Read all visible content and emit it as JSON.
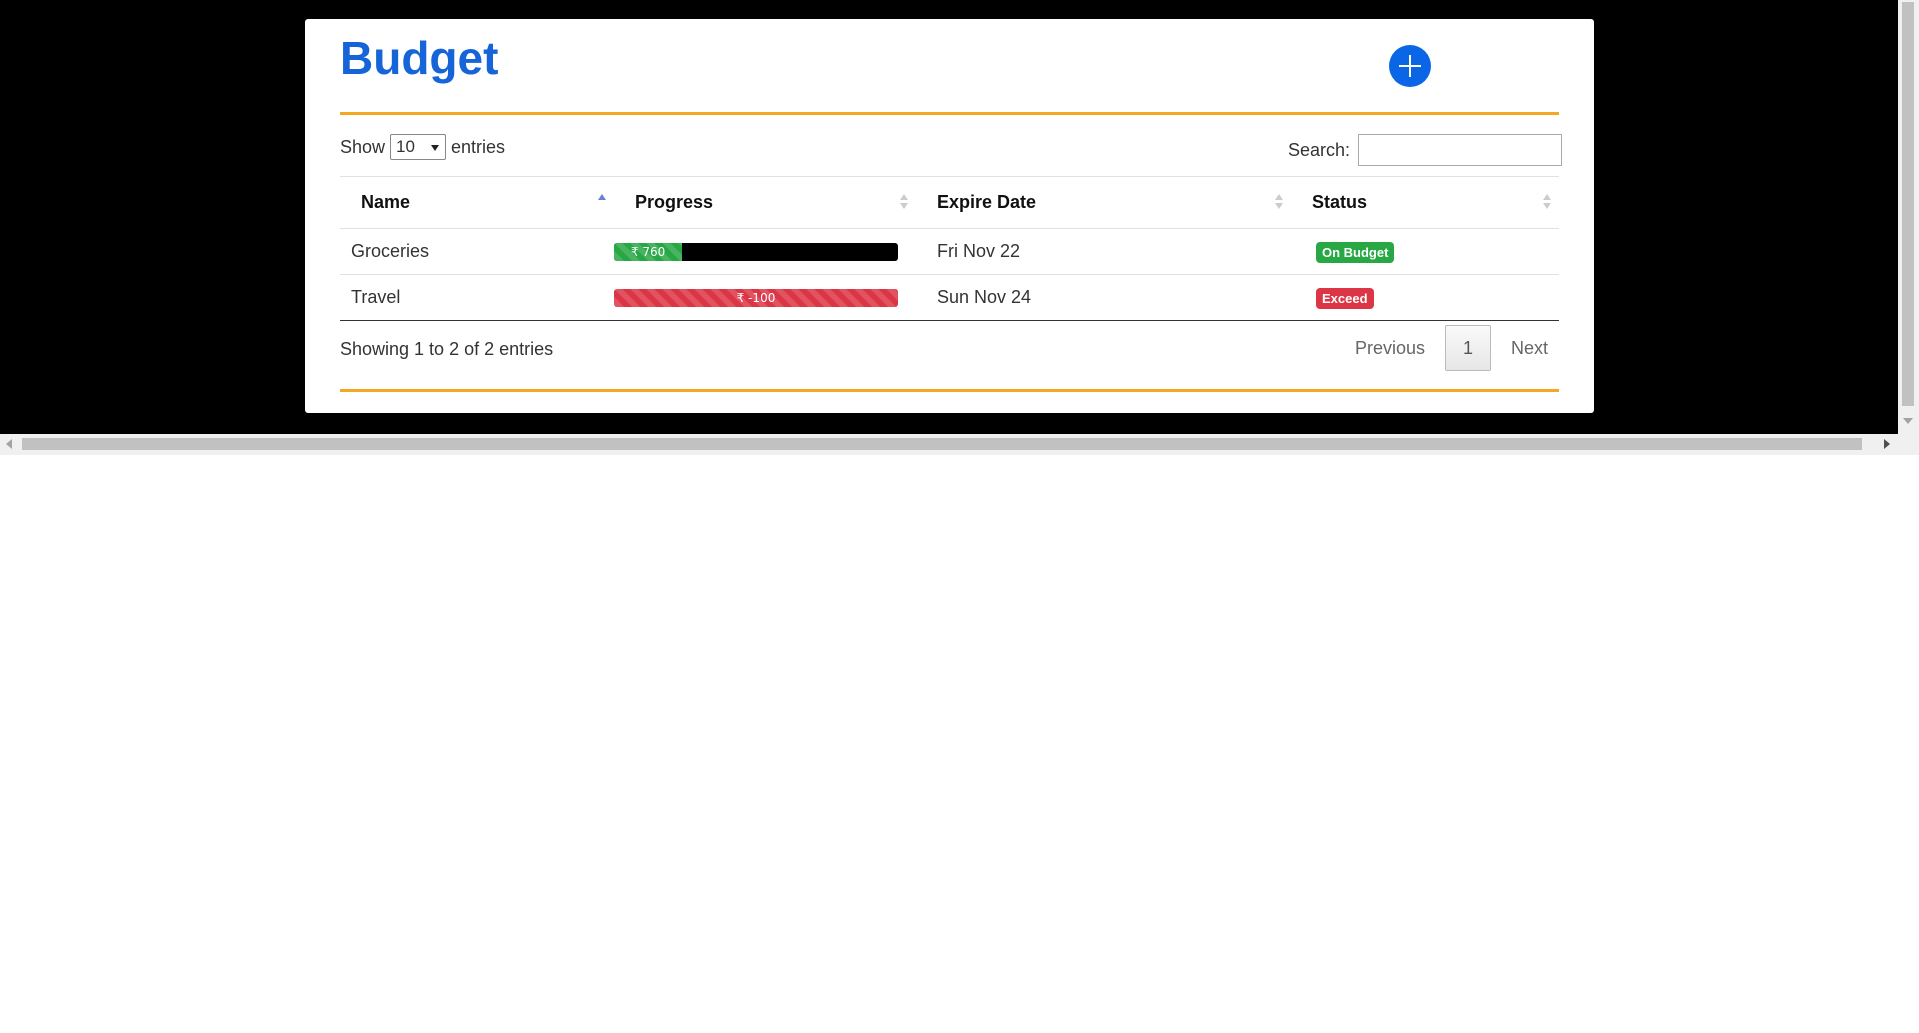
{
  "page": {
    "title": "Budget"
  },
  "colors": {
    "title": "#1565d8",
    "accent_rule": "#f5a623",
    "add_button": "#0a66e4",
    "on_budget": "#28a745",
    "exceed": "#dc3545"
  },
  "icons": {
    "add": "plus-circle-icon"
  },
  "length_control": {
    "prefix": "Show",
    "selected": "10",
    "suffix": "entries"
  },
  "search": {
    "label": "Search:",
    "value": "",
    "placeholder": ""
  },
  "table": {
    "columns": [
      {
        "label": "Name",
        "sort": "ascending"
      },
      {
        "label": "Progress",
        "sort": "none"
      },
      {
        "label": "Expire Date",
        "sort": "none"
      },
      {
        "label": "Status",
        "sort": "none"
      }
    ],
    "rows": [
      {
        "name": "Groceries",
        "progress_label": "₹ 760",
        "progress_fraction": 0.24,
        "progress_color": "green",
        "expire": "Fri Nov 22",
        "status": "On Budget",
        "status_type": "ok"
      },
      {
        "name": "Travel",
        "progress_label": "₹ -100",
        "progress_fraction": 1.0,
        "progress_color": "red",
        "expire": "Sun Nov 24",
        "status": "Exceed",
        "status_type": "bad"
      }
    ]
  },
  "footer": {
    "info": "Showing 1 to 2 of 2 entries",
    "previous": "Previous",
    "current_page": "1",
    "next": "Next"
  }
}
